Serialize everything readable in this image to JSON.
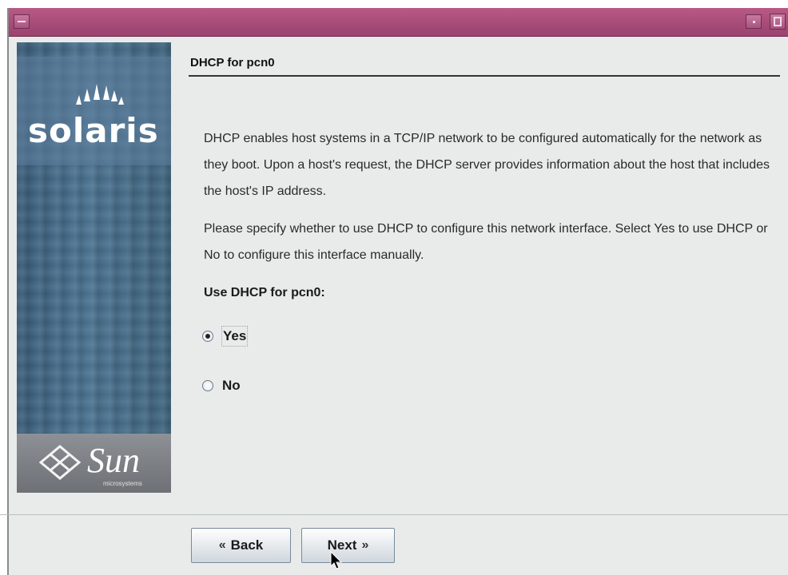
{
  "window": {
    "title": "",
    "accent_color": "#a64a76"
  },
  "sidebar": {
    "brand": "solaris",
    "company": "Sun",
    "company_sub": "microsystems"
  },
  "page": {
    "title": "DHCP for pcn0",
    "paragraph1": "DHCP enables host systems in a TCP/IP network to be configured automatically for the network as they boot. Upon a host's request, the DHCP server provides information about the host that includes the host's IP address.",
    "paragraph2": "Please specify whether to use DHCP to configure this network interface. Select Yes to use DHCP or No to configure this interface manually.",
    "question": "Use DHCP for pcn0:"
  },
  "options": [
    {
      "label": "Yes",
      "selected": true
    },
    {
      "label": "No",
      "selected": false
    }
  ],
  "buttons": {
    "back": "Back",
    "next": "Next"
  },
  "icons": {
    "back_chevron": "double-chevron-left-icon",
    "next_chevron": "double-chevron-right-icon",
    "cursor": "mouse-pointer-icon"
  }
}
